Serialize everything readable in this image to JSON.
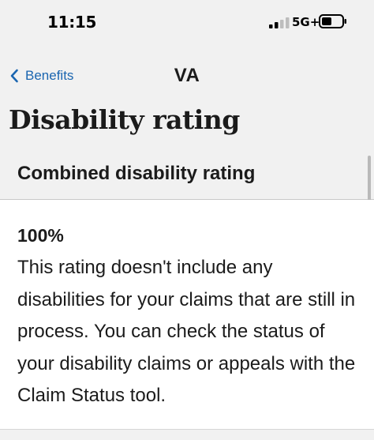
{
  "status_bar": {
    "time": "11:15",
    "network": "5G+",
    "signal_bars_active": 2,
    "signal_bars_total": 4
  },
  "nav": {
    "back_label": "Benefits",
    "title": "VA"
  },
  "page": {
    "title": "Disability rating",
    "section_heading": "Combined disability rating"
  },
  "rating": {
    "value": "100%",
    "description": "This rating doesn't include any disabilities for your claims that are still in process. You can check the status of your disability claims or appeals with the Claim Status tool."
  },
  "colors": {
    "link": "#1a65b0",
    "header_bg": "#f1f1f1",
    "text": "#1b1b1b"
  },
  "icons": {
    "back": "chevron-left-icon",
    "signal": "cellular-signal-icon",
    "battery": "battery-icon"
  }
}
